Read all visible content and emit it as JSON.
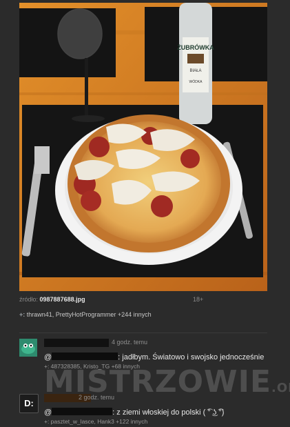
{
  "post": {
    "source_label": "źródło:",
    "source_file": "0987887688.jpg",
    "age_rating": "18+",
    "plus_prefix": "+:",
    "plus_list": "thrawn41, PrettyHotProgrammer +244 innych",
    "bottle_brand": "ŻUBRÓWKA",
    "bottle_sub": "BIAŁA",
    "bottle_type": "WÓDKA"
  },
  "comments": [
    {
      "avatar": "",
      "time": "4 godz. temu",
      "text_prefix": "@",
      "text_body": ": jadłbym. Światowo i swojsko jednocześnie",
      "plus": "+: 487328385, Kristo_TG +68 innych"
    },
    {
      "avatar": "D:",
      "time": "2 godz. temu",
      "text_prefix": "@",
      "text_body": ": z ziemi włoskiej do polski ( ͡° ͜ʖ ͡°)",
      "plus": "+: pasztet_w_lasce, Hank3 +122 innych"
    }
  ],
  "watermark": {
    "main": "MISTRZOWIE",
    "suffix": ".ORG"
  }
}
